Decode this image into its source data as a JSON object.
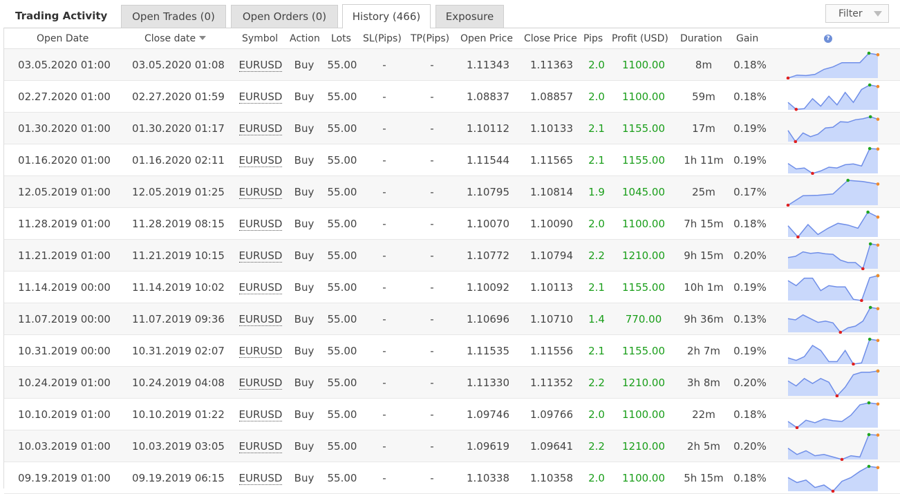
{
  "panel": {
    "title": "Trading Activity"
  },
  "tabs": [
    {
      "label": "Open Trades (0)",
      "active": false
    },
    {
      "label": "Open Orders (0)",
      "active": false
    },
    {
      "label": "History (466)",
      "active": true
    },
    {
      "label": "Exposure",
      "active": false
    }
  ],
  "filter": {
    "label": "Filter"
  },
  "columns": [
    "Open Date",
    "Close date",
    "Symbol",
    "Action",
    "Lots",
    "SL(Pips)",
    "TP(Pips)",
    "Open Price",
    "Close Price",
    "Pips",
    "Profit (USD)",
    "Duration",
    "Gain"
  ],
  "help_icon": {
    "glyph": "?"
  },
  "colors": {
    "profit": "#1a9e1a",
    "spark_fill": "#c9d8fb",
    "spark_line": "#6f8ee8",
    "spark_min": "#e02020",
    "spark_max": "#1fa51f",
    "spark_end": "#f08a2c"
  },
  "rows": [
    {
      "open": "03.05.2020 01:00",
      "close": "03.05.2020 01:08",
      "symbol": "EURUSD",
      "action": "Buy",
      "lots": "55.00",
      "sl": "-",
      "tp": "-",
      "open_price": "1.11343",
      "close_price": "1.11363",
      "pips": "2.0",
      "profit": "1100.00",
      "duration": "8m",
      "gain": "0.18%",
      "spark": [
        0,
        0.12,
        0.1,
        0.15,
        0.35,
        0.45,
        0.62,
        0.62,
        0.62,
        1.0,
        0.94
      ]
    },
    {
      "open": "02.27.2020 01:00",
      "close": "02.27.2020 01:59",
      "symbol": "EURUSD",
      "action": "Buy",
      "lots": "55.00",
      "sl": "-",
      "tp": "-",
      "open_price": "1.08837",
      "close_price": "1.08857",
      "pips": "2.0",
      "profit": "1100.00",
      "duration": "59m",
      "gain": "0.18%",
      "spark": [
        0.3,
        0.02,
        0.05,
        0.45,
        0.15,
        0.55,
        0.2,
        0.7,
        0.3,
        0.82,
        1.0,
        0.94
      ]
    },
    {
      "open": "01.30.2020 01:00",
      "close": "01.30.2020 01:17",
      "symbol": "EURUSD",
      "action": "Buy",
      "lots": "55.00",
      "sl": "-",
      "tp": "-",
      "open_price": "1.10112",
      "close_price": "1.10133",
      "pips": "2.1",
      "profit": "1155.00",
      "duration": "17m",
      "gain": "0.19%",
      "spark": [
        0.45,
        0.0,
        0.35,
        0.2,
        0.3,
        0.55,
        0.58,
        0.8,
        0.78,
        0.88,
        0.92,
        1.0,
        0.9
      ]
    },
    {
      "open": "01.16.2020 01:00",
      "close": "01.16.2020 02:11",
      "symbol": "EURUSD",
      "action": "Buy",
      "lots": "55.00",
      "sl": "-",
      "tp": "-",
      "open_price": "1.11544",
      "close_price": "1.11565",
      "pips": "2.1",
      "profit": "1155.00",
      "duration": "1h 11m",
      "gain": "0.19%",
      "spark": [
        0.4,
        0.18,
        0.22,
        0.0,
        0.1,
        0.25,
        0.22,
        0.35,
        0.38,
        0.3,
        1.0,
        0.98
      ]
    },
    {
      "open": "12.05.2019 01:00",
      "close": "12.05.2019 01:25",
      "symbol": "EURUSD",
      "action": "Buy",
      "lots": "55.00",
      "sl": "-",
      "tp": "-",
      "open_price": "1.10795",
      "close_price": "1.10814",
      "pips": "1.9",
      "profit": "1045.00",
      "duration": "25m",
      "gain": "0.17%",
      "spark": [
        0,
        0.38,
        0.4,
        0.45,
        1.0,
        0.95,
        0.85
      ]
    },
    {
      "open": "11.28.2019 01:00",
      "close": "11.28.2019 08:15",
      "symbol": "EURUSD",
      "action": "Buy",
      "lots": "55.00",
      "sl": "-",
      "tp": "-",
      "open_price": "1.10070",
      "close_price": "1.10090",
      "pips": "2.0",
      "profit": "1100.00",
      "duration": "7h 15m",
      "gain": "0.18%",
      "spark": [
        0.45,
        0.0,
        0.5,
        0.1,
        0.35,
        0.55,
        0.48,
        0.35,
        1.0,
        0.8
      ]
    },
    {
      "open": "11.21.2019 01:00",
      "close": "11.21.2019 10:15",
      "symbol": "EURUSD",
      "action": "Buy",
      "lots": "55.00",
      "sl": "-",
      "tp": "-",
      "open_price": "1.10772",
      "close_price": "1.10794",
      "pips": "2.2",
      "profit": "1210.00",
      "duration": "9h 15m",
      "gain": "0.20%",
      "spark": [
        0.45,
        0.5,
        0.68,
        0.62,
        0.65,
        0.6,
        0.58,
        0.35,
        0.25,
        0.25,
        0.0,
        1.0,
        0.95
      ]
    },
    {
      "open": "11.14.2019 00:00",
      "close": "11.14.2019 10:02",
      "symbol": "EURUSD",
      "action": "Buy",
      "lots": "55.00",
      "sl": "-",
      "tp": "-",
      "open_price": "1.10092",
      "close_price": "1.10113",
      "pips": "2.1",
      "profit": "1155.00",
      "duration": "10h 1m",
      "gain": "0.19%",
      "spark": [
        0.8,
        0.6,
        0.9,
        0.9,
        0.4,
        0.6,
        0.55,
        0.55,
        0.05,
        0.0,
        0.92,
        1.0
      ]
    },
    {
      "open": "11.07.2019 00:00",
      "close": "11.07.2019 09:36",
      "symbol": "EURUSD",
      "action": "Buy",
      "lots": "55.00",
      "sl": "-",
      "tp": "-",
      "open_price": "1.10696",
      "close_price": "1.10710",
      "pips": "1.4",
      "profit": "770.00",
      "duration": "9h 36m",
      "gain": "0.13%",
      "spark": [
        0.55,
        0.5,
        0.7,
        0.55,
        0.4,
        0.45,
        0.38,
        0.0,
        0.18,
        0.25,
        0.45,
        1.0,
        0.95
      ]
    },
    {
      "open": "10.31.2019 00:00",
      "close": "10.31.2019 02:07",
      "symbol": "EURUSD",
      "action": "Buy",
      "lots": "55.00",
      "sl": "-",
      "tp": "-",
      "open_price": "1.11535",
      "close_price": "1.11556",
      "pips": "2.1",
      "profit": "1155.00",
      "duration": "2h 7m",
      "gain": "0.19%",
      "spark": [
        0.25,
        0.15,
        0.3,
        0.75,
        0.55,
        0.1,
        0.1,
        0.55,
        0.0,
        0.05,
        1.0,
        0.95
      ]
    },
    {
      "open": "10.24.2019 01:00",
      "close": "10.24.2019 04:08",
      "symbol": "EURUSD",
      "action": "Buy",
      "lots": "55.00",
      "sl": "-",
      "tp": "-",
      "open_price": "1.11330",
      "close_price": "1.11352",
      "pips": "2.2",
      "profit": "1210.00",
      "duration": "3h 8m",
      "gain": "0.20%",
      "spark": [
        0.6,
        0.4,
        0.7,
        0.5,
        0.7,
        0.55,
        0.0,
        0.35,
        0.85,
        0.95,
        0.95,
        1.0
      ]
    },
    {
      "open": "10.10.2019 01:00",
      "close": "10.10.2019 01:22",
      "symbol": "EURUSD",
      "action": "Buy",
      "lots": "55.00",
      "sl": "-",
      "tp": "-",
      "open_price": "1.09746",
      "close_price": "1.09766",
      "pips": "2.0",
      "profit": "1100.00",
      "duration": "22m",
      "gain": "0.18%",
      "spark": [
        0.25,
        0.0,
        0.3,
        0.2,
        0.35,
        0.28,
        0.25,
        0.5,
        0.92,
        1.0,
        0.95
      ]
    },
    {
      "open": "10.03.2019 01:00",
      "close": "10.03.2019 03:05",
      "symbol": "EURUSD",
      "action": "Buy",
      "lots": "55.00",
      "sl": "-",
      "tp": "-",
      "open_price": "1.09619",
      "close_price": "1.09641",
      "pips": "2.2",
      "profit": "1210.00",
      "duration": "2h 5m",
      "gain": "0.20%",
      "spark": [
        0.45,
        0.2,
        0.35,
        0.15,
        0.2,
        0.1,
        0.0,
        0.15,
        0.1,
        1.0,
        0.98
      ]
    },
    {
      "open": "09.19.2019 01:00",
      "close": "09.19.2019 06:15",
      "symbol": "EURUSD",
      "action": "Buy",
      "lots": "55.00",
      "sl": "-",
      "tp": "-",
      "open_price": "1.10338",
      "close_price": "1.10358",
      "pips": "2.0",
      "profit": "1100.00",
      "duration": "5h 15m",
      "gain": "0.18%",
      "spark": [
        0.55,
        0.35,
        0.45,
        0.15,
        0.25,
        0.0,
        0.4,
        0.55,
        0.8,
        1.0,
        0.95
      ]
    }
  ]
}
